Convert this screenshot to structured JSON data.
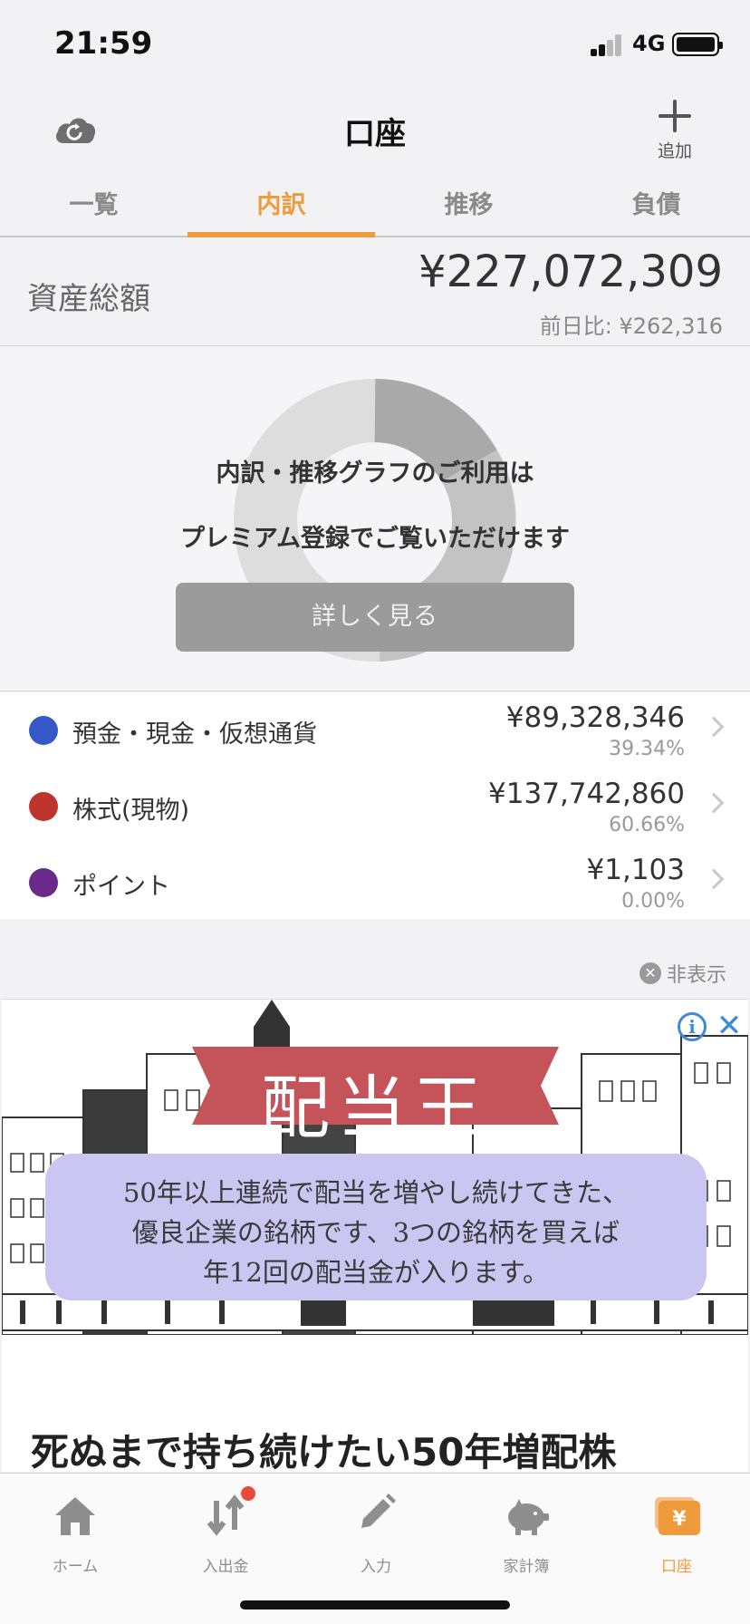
{
  "status_bar": {
    "time": "21:59",
    "network": "4G"
  },
  "header": {
    "title": "口座",
    "add_label": "追加",
    "sync_icon": "cloud-sync-icon",
    "add_icon": "plus-icon"
  },
  "tabs": [
    {
      "label": "一覧",
      "active": false
    },
    {
      "label": "内訳",
      "active": true
    },
    {
      "label": "推移",
      "active": false
    },
    {
      "label": "負債",
      "active": false
    }
  ],
  "summary": {
    "label": "資産総額",
    "total": "¥227,072,309",
    "diff": "前日比: ¥262,316"
  },
  "chart_notice": {
    "line1": "内訳・推移グラフのご利用は",
    "line2": "プレミアム登録でご覧いただけます",
    "button": "詳しく見る"
  },
  "breakdown": [
    {
      "label": "預金・現金・仮想通貨",
      "amount": "¥89,328,346",
      "percent": "39.34%",
      "color": "#3558c6"
    },
    {
      "label": "株式(現物)",
      "amount": "¥137,742,860",
      "percent": "60.66%",
      "color": "#c0342e"
    },
    {
      "label": "ポイント",
      "amount": "¥1,103",
      "percent": "0.00%",
      "color": "#6a2a8a"
    }
  ],
  "hide_label": "非表示",
  "ad": {
    "brand": "配当王",
    "copy_line1": "50年以上連続で配当を増やし続けてきた、",
    "copy_line2": "優良企業の銘柄です、3つの銘柄を買えば",
    "copy_line3": "年12回の配当金が入ります。",
    "headline": "死ぬまで持ち続けたい50年増配株"
  },
  "tabbar": [
    {
      "label": "ホーム",
      "icon": "home-icon",
      "active": false
    },
    {
      "label": "入出金",
      "icon": "transfer-arrows-icon",
      "active": false,
      "badge": true
    },
    {
      "label": "入力",
      "icon": "pencil-icon",
      "active": false
    },
    {
      "label": "家計簿",
      "icon": "piggy-bank-icon",
      "active": false
    },
    {
      "label": "口座",
      "icon": "yen-wallet-icon",
      "active": true
    }
  ],
  "colors": {
    "accent": "#ef9a3b",
    "badge": "#e84a3b",
    "ad_ribbon": "#c4545a",
    "ad_bubble": "#c9c7f2"
  }
}
